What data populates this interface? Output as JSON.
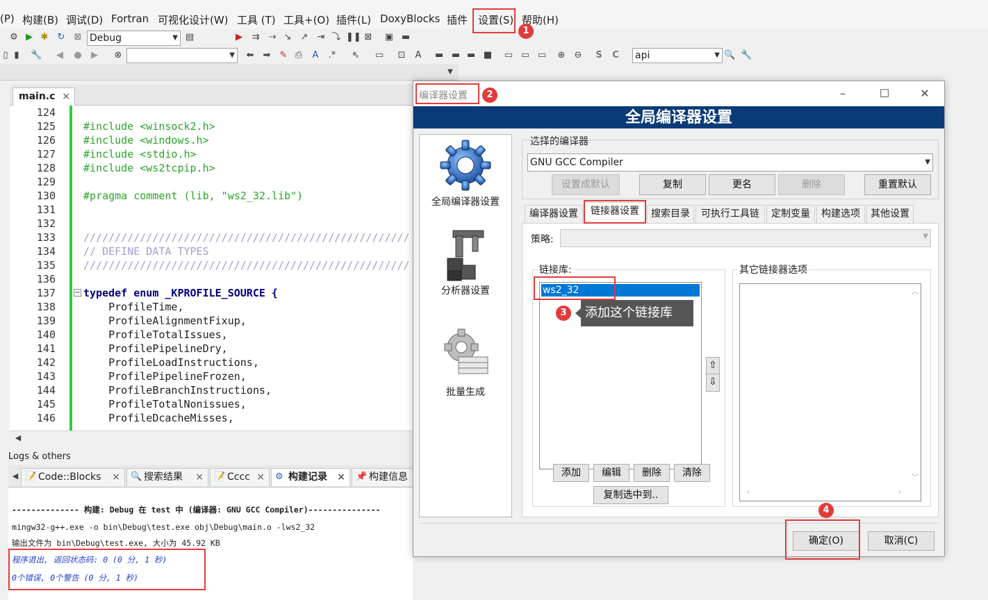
{
  "menu": {
    "items": [
      "(P)",
      "构建(B)",
      "调试(D)",
      "Fortran",
      "可视化设计(W)",
      "工具 (T)",
      "工具+(O)",
      "插件(L)",
      "DoxyBlocks",
      "插件",
      "设置(S)",
      "帮助(H)"
    ]
  },
  "toolbar": {
    "build_target": "Debug",
    "search_value": "api"
  },
  "editor": {
    "tab_label": "main.c",
    "close_glyph": "×",
    "line_numbers": [
      "124",
      "125",
      "126",
      "127",
      "128",
      "129",
      "130",
      "131",
      "132",
      "133",
      "134",
      "135",
      "136",
      "137",
      "138",
      "139",
      "140",
      "141",
      "142",
      "143",
      "144",
      "145",
      "146"
    ],
    "lines": [
      "",
      "#include <winsock2.h>",
      "#include <windows.h>",
      "#include <stdio.h>",
      "#include <ws2tcpip.h>",
      "",
      "#pragma comment (lib, \"ws2_32.lib\")",
      "",
      "",
      "////////////////////////////////////////////////////",
      "// DEFINE DATA TYPES",
      "////////////////////////////////////////////////////",
      "",
      "typedef enum _KPROFILE_SOURCE {",
      "    ProfileTime,",
      "    ProfileAlignmentFixup,",
      "    ProfileTotalIssues,",
      "    ProfilePipelineDry,",
      "    ProfileLoadInstructions,",
      "    ProfilePipelineFrozen,",
      "    ProfileBranchInstructions,",
      "    ProfileTotalNonissues,",
      "    ProfileDcacheMisses,"
    ]
  },
  "logs": {
    "title": "Logs & others",
    "tabs": [
      {
        "label": "Code::Blocks",
        "icon": "document-icon"
      },
      {
        "label": "搜索结果",
        "icon": "search-icon"
      },
      {
        "label": "Cccc",
        "icon": "document-icon"
      },
      {
        "label": "构建记录",
        "icon": "gear-icon"
      },
      {
        "label": "构建信息",
        "icon": "pin-icon"
      }
    ],
    "lines": [
      "-------------- 构建: Debug 在 test 中 (编译器: GNU GCC Compiler)---------------",
      "mingw32-g++.exe  -o bin\\Debug\\test.exe obj\\Debug\\main.o   -lws2_32",
      "输出文件为 bin\\Debug\\test.exe, 大小为 45.92 KB",
      "程序退出, 返回状态码: 0 (0 分, 1 秒)",
      "0个错误, 0个警告 (0 分, 1 秒)"
    ]
  },
  "dialog": {
    "title": "编译器设置",
    "header": "全局编译器设置",
    "sidebar": [
      {
        "label": "全局编译器设置"
      },
      {
        "label": "分析器设置"
      },
      {
        "label": "批量生成"
      }
    ],
    "selected_compiler_label": "选择的编译器",
    "selected_compiler": "GNU GCC Compiler",
    "compiler_buttons": {
      "set_default": "设置成默认",
      "copy": "复制",
      "rename": "更名",
      "delete": "删除",
      "reset_defaults": "重置默认"
    },
    "tabs": [
      "编译器设置",
      "链接器设置",
      "搜索目录",
      "可执行工具链",
      "定制变量",
      "构建选项",
      "其他设置"
    ],
    "policy_label": "策略:",
    "link_libs_label": "链接库:",
    "link_libs": [
      "ws2_32"
    ],
    "other_options_label": "其它链接器选项",
    "lib_buttons": {
      "add": "添加",
      "edit": "编辑",
      "delete": "删除",
      "clear": "清除",
      "copy_selected": "复制选中到.."
    },
    "ok": "确定(O)",
    "cancel": "取消(C)"
  },
  "annotations": {
    "tooltip": "添加这个链接库",
    "badges": [
      "1",
      "2",
      "3",
      "4"
    ]
  },
  "colors": {
    "header_bg": "#0a3a78",
    "selection": "#0078d7",
    "annotation_red": "#e23b3b",
    "code_green": "#2aa52a"
  }
}
